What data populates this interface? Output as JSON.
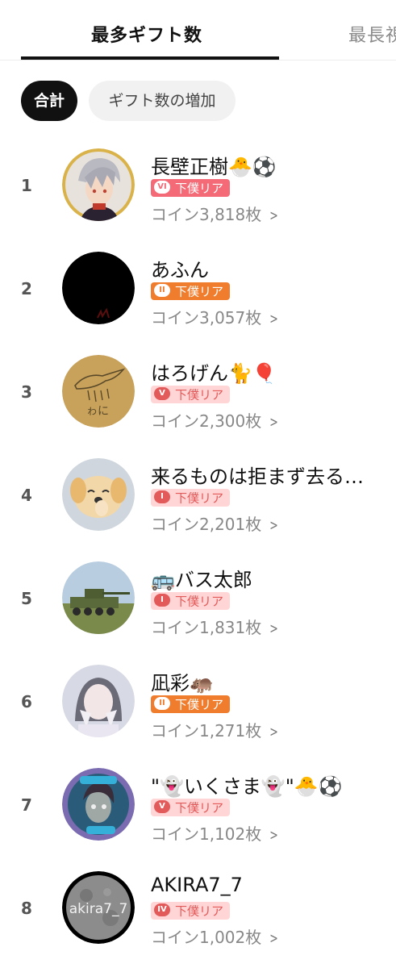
{
  "tabs": [
    {
      "label": "最多ギフト数"
    },
    {
      "label": "最長視"
    }
  ],
  "chips": [
    {
      "label": "合計"
    },
    {
      "label": "ギフト数の増加"
    }
  ],
  "colors": {
    "badge_vi_bg": "#f46a77",
    "badge_vi_text": "#ffffff",
    "badge_ii_bg": "#f07d2d",
    "badge_ii_text": "#ffffff",
    "badge_v_bg": "#ffd5d5",
    "badge_v_text": "#e35a5a",
    "badge_i_bg": "#ffd5d5",
    "badge_i_text": "#e35a5a",
    "badge_iv_bg": "#ffd5d5",
    "badge_iv_text": "#e35a5a"
  },
  "rows": [
    {
      "rank": "1",
      "name": "長壁正樹🐣⚽",
      "badge_level": "VI",
      "badge_label": "下僕リア",
      "coins": "コイン3,818枚",
      "avatar": "anime-boy-avatar"
    },
    {
      "rank": "2",
      "name": "あふん",
      "badge_level": "II",
      "badge_label": "下僕リア",
      "coins": "コイン3,057枚",
      "avatar": "dark-avatar"
    },
    {
      "rank": "3",
      "name": "はろげん🐈🎈",
      "badge_level": "V",
      "badge_label": "下僕リア",
      "coins": "コイン2,300枚",
      "avatar": "drawing-avatar"
    },
    {
      "rank": "4",
      "name": "来るものは拒まず去る…",
      "badge_level": "I",
      "badge_label": "下僕リア",
      "coins": "コイン2,201枚",
      "avatar": "puppy-avatar"
    },
    {
      "rank": "5",
      "name": "🚌バス太郎",
      "badge_level": "I",
      "badge_label": "下僕リア",
      "coins": "コイン1,831枚",
      "avatar": "tank-avatar"
    },
    {
      "rank": "6",
      "name": "凪彩🦛",
      "badge_level": "II",
      "badge_label": "下僕リア",
      "coins": "コイン1,271枚",
      "avatar": "girl-avatar"
    },
    {
      "rank": "7",
      "name": "\"👻いくさま👻\"🐣⚽",
      "badge_level": "V",
      "badge_label": "下僕リア",
      "coins": "コイン1,102枚",
      "avatar": "character-avatar"
    },
    {
      "rank": "8",
      "name": "AKIRA7_7",
      "badge_level": "IV",
      "badge_label": "下僕リア",
      "coins": "コイン1,002枚",
      "avatar": "moon-avatar"
    }
  ]
}
